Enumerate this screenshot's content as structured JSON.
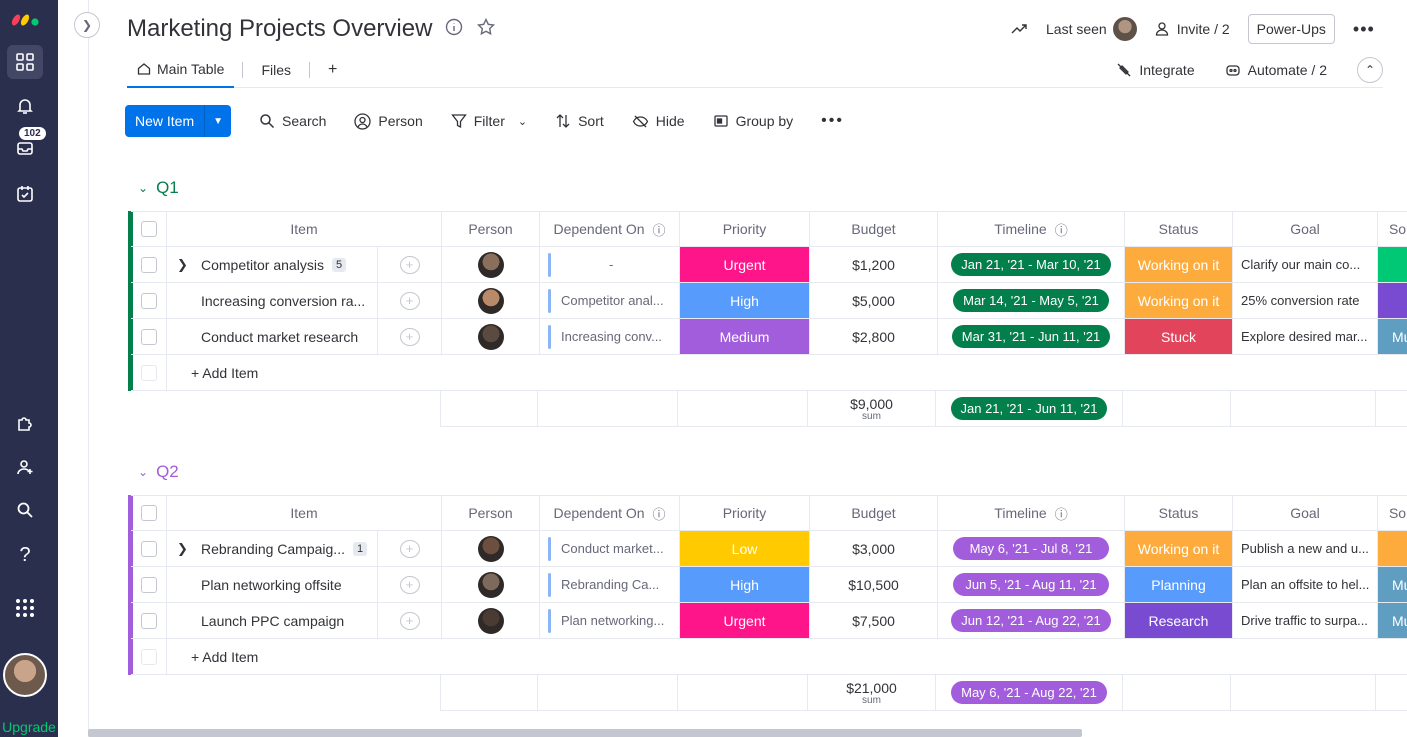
{
  "sidebar": {
    "inbox_badge": "102",
    "upgrade_label": "Upgrade"
  },
  "header": {
    "title": "Marketing Projects Overview",
    "last_seen_label": "Last seen",
    "invite_label": "Invite / 2",
    "powerups_label": "Power-Ups"
  },
  "tabs": {
    "main_table": "Main Table",
    "files": "Files",
    "add": "+",
    "integrate": "Integrate",
    "automate": "Automate / 2"
  },
  "toolbar": {
    "new_item": "New Item",
    "search": "Search",
    "person": "Person",
    "filter": "Filter",
    "sort": "Sort",
    "hide": "Hide",
    "group_by": "Group by"
  },
  "columns": {
    "item": "Item",
    "person": "Person",
    "dependent_on": "Dependent On",
    "priority": "Priority",
    "budget": "Budget",
    "timeline": "Timeline",
    "status": "Status",
    "goal": "Goal",
    "so": "So"
  },
  "groups": [
    {
      "name": "Q1",
      "color": "#037f4c",
      "add_item": "+ Add Item",
      "rows": [
        {
          "item": "Competitor analysis",
          "subitems": "5",
          "dependent": "-",
          "priority": "Urgent",
          "priority_color": "#ff158a",
          "budget": "$1,200",
          "timeline": "Jan 21, '21 - Mar 10, '21",
          "status": "Working on it",
          "status_color": "#fdab3d",
          "goal": "Clarify our main co...",
          "so_color": "#00c875",
          "so": ""
        },
        {
          "item": "Increasing conversion ra...",
          "subitems": "",
          "dependent": "Competitor anal...",
          "priority": "High",
          "priority_color": "#579bfc",
          "budget": "$5,000",
          "timeline": "Mar 14, '21 - May 5, '21",
          "status": "Working on it",
          "status_color": "#fdab3d",
          "goal": "25% conversion rate",
          "so_color": "#784bd1",
          "so": ""
        },
        {
          "item": "Conduct market research",
          "subitems": "",
          "dependent": "Increasing conv...",
          "priority": "Medium",
          "priority_color": "#a25ddc",
          "budget": "$2,800",
          "timeline": "Mar 31, '21 - Jun 11, '21",
          "status": "Stuck",
          "status_color": "#e2445c",
          "goal": "Explore desired mar...",
          "so_color": "#5f9ec0",
          "so": "Mu"
        }
      ],
      "sum_budget": "$9,000",
      "sum_label": "sum",
      "sum_timeline": "Jan 21, '21 - Jun 11, '21"
    },
    {
      "name": "Q2",
      "color": "#a25ddc",
      "add_item": "+ Add Item",
      "rows": [
        {
          "item": "Rebranding Campaig...",
          "subitems": "1",
          "dependent": "Conduct market...",
          "priority": "Low",
          "priority_color": "#ffcb00",
          "budget": "$3,000",
          "timeline": "May 6, '21 - Jul 8, '21",
          "status": "Working on it",
          "status_color": "#fdab3d",
          "goal": "Publish a new and u...",
          "so_color": "#fdab3d",
          "so": ""
        },
        {
          "item": "Plan networking offsite",
          "subitems": "",
          "dependent": "Rebranding Ca...",
          "priority": "High",
          "priority_color": "#579bfc",
          "budget": "$10,500",
          "timeline": "Jun 5, '21 - Aug 11, '21",
          "status": "Planning",
          "status_color": "#579bfc",
          "goal": "Plan an offsite to hel...",
          "so_color": "#5f9ec0",
          "so": "Mu"
        },
        {
          "item": "Launch PPC campaign",
          "subitems": "",
          "dependent": "Plan networking...",
          "priority": "Urgent",
          "priority_color": "#ff158a",
          "budget": "$7,500",
          "timeline": "Jun 12, '21 - Aug 22, '21",
          "status": "Research",
          "status_color": "#784bd1",
          "goal": "Drive traffic to surpa...",
          "so_color": "#5f9ec0",
          "so": "Mu"
        }
      ],
      "sum_budget": "$21,000",
      "sum_label": "sum",
      "sum_timeline": "May 6, '21 - Aug 22, '21"
    }
  ],
  "colors": {
    "accent": "#0073ea",
    "sidebar": "#292f4c",
    "q1_timeline": "#037f4c",
    "q2_timeline": "#a25ddc"
  }
}
